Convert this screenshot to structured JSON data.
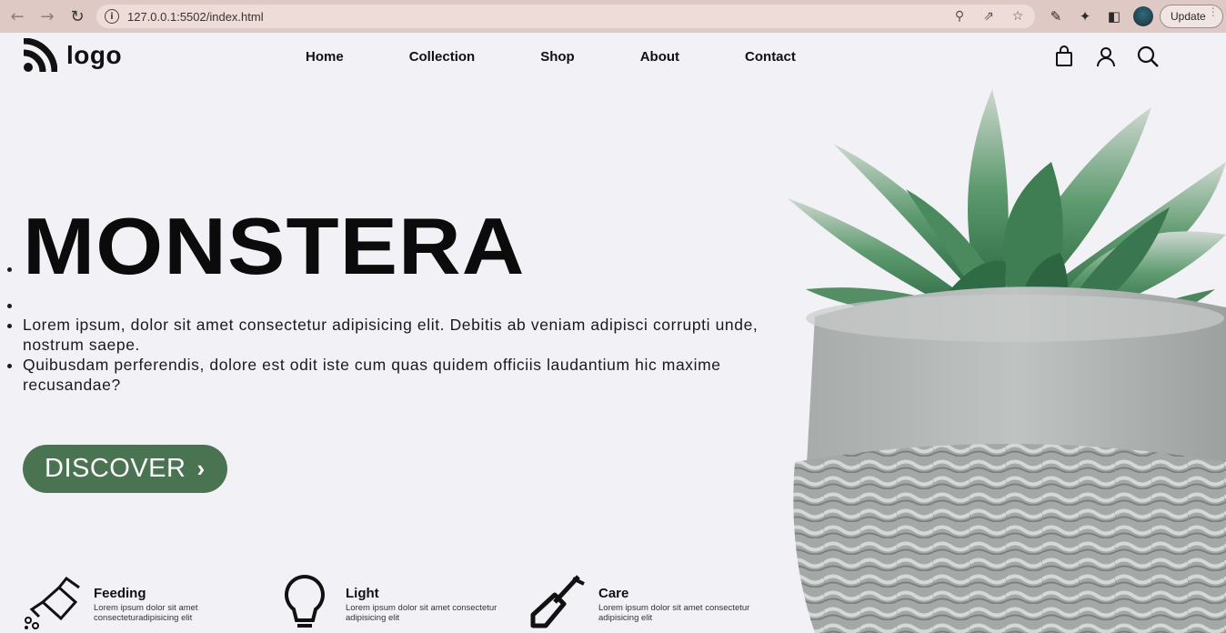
{
  "browser": {
    "url": "127.0.0.1:5502/index.html",
    "update_label": "Update"
  },
  "site": {
    "logo_text": "logo",
    "nav": [
      "Home",
      "Collection",
      "Shop",
      "About",
      "Contact"
    ]
  },
  "hero": {
    "title": "MONSTERA",
    "bullets": [
      "Lorem ipsum, dolor sit amet consectetur adipisicing elit. Debitis ab veniam adipisci corrupti unde, nostrum saepe.",
      "Quibusdam perferendis, dolore est odit iste cum quas quidem officiis laudantium hic maxime recusandae?"
    ],
    "cta_label": "DISCOVER",
    "cta_color": "#4a7352"
  },
  "features": [
    {
      "title": "Feeding",
      "description": "Lorem ipsum dolor sit amet consecteturadipisicing elit",
      "icon": "watering-can-icon"
    },
    {
      "title": "Light",
      "description": "Lorem ipsum dolor sit amet consectetur adipisicing elit",
      "icon": "light-bulb-icon"
    },
    {
      "title": "Care",
      "description": "Lorem ipsum dolor sit amet consectetur adipisicing elit",
      "icon": "shovel-icon"
    }
  ]
}
